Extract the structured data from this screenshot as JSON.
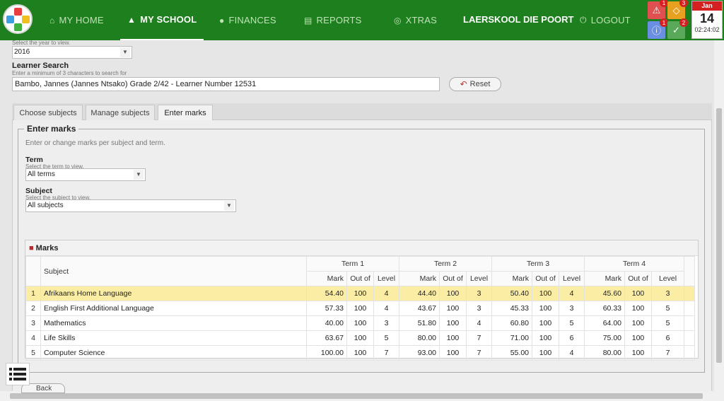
{
  "nav": {
    "items": [
      {
        "label": "MY HOME",
        "icon": "home-icon"
      },
      {
        "label": "MY SCHOOL",
        "icon": "school-icon"
      },
      {
        "label": "FINANCES",
        "icon": "money-bag-icon"
      },
      {
        "label": "REPORTS",
        "icon": "document-icon"
      },
      {
        "label": "XTRAS",
        "icon": "crosshair-icon"
      }
    ],
    "active": "MY SCHOOL",
    "school_name": "LAERSKOOL DIE POORT",
    "logout": "LOGOUT"
  },
  "notifications": [
    {
      "icon": "warning-triangle-icon",
      "count": "1",
      "color": "#e05050"
    },
    {
      "icon": "warning-diamond-icon",
      "count": "3",
      "color": "#e8a020"
    },
    {
      "icon": "info-icon",
      "count": "1",
      "color": "#6a8fe0"
    },
    {
      "icon": "check-icon",
      "count": "2",
      "color": "#5aa85a"
    }
  ],
  "date": {
    "month": "Jan",
    "day": "14",
    "time": "02:24:02"
  },
  "year": {
    "hint": "Select the year to view.",
    "value": "2016"
  },
  "learner_search": {
    "label": "Learner Search",
    "hint": "Enter a minimum of 3 characters to search for",
    "value": "Bambo, Jannes (Jannes Ntsako) Grade 2/42 - Learner Number 12531",
    "reset": "Reset"
  },
  "tabs": [
    "Choose subjects",
    "Manage subjects",
    "Enter marks"
  ],
  "active_tab": "Enter marks",
  "enter_marks": {
    "title": "Enter marks",
    "description": "Enter or change marks per subject and term.",
    "term": {
      "label": "Term",
      "hint": "Select the term to view.",
      "value": "All terms"
    },
    "subject": {
      "label": "Subject",
      "hint": "Select the subject to view.",
      "value": "All subjects"
    }
  },
  "marks": {
    "caption": "Marks",
    "subject_header": "Subject",
    "terms": [
      "Term 1",
      "Term 2",
      "Term 3",
      "Term 4"
    ],
    "subcols": [
      "Mark",
      "Out of",
      "Level"
    ],
    "rows": [
      {
        "n": "1",
        "subject": "Afrikaans Home Language",
        "t": [
          [
            "54.40",
            "100",
            "4"
          ],
          [
            "44.40",
            "100",
            "3"
          ],
          [
            "50.40",
            "100",
            "4"
          ],
          [
            "45.60",
            "100",
            "3"
          ]
        ]
      },
      {
        "n": "2",
        "subject": "English First Additional Language",
        "t": [
          [
            "57.33",
            "100",
            "4"
          ],
          [
            "43.67",
            "100",
            "3"
          ],
          [
            "45.33",
            "100",
            "3"
          ],
          [
            "60.33",
            "100",
            "5"
          ]
        ]
      },
      {
        "n": "3",
        "subject": "Mathematics",
        "t": [
          [
            "40.00",
            "100",
            "3"
          ],
          [
            "51.80",
            "100",
            "4"
          ],
          [
            "60.80",
            "100",
            "5"
          ],
          [
            "64.00",
            "100",
            "5"
          ]
        ]
      },
      {
        "n": "4",
        "subject": "Life Skills",
        "t": [
          [
            "63.67",
            "100",
            "5"
          ],
          [
            "80.00",
            "100",
            "7"
          ],
          [
            "71.00",
            "100",
            "6"
          ],
          [
            "75.00",
            "100",
            "6"
          ]
        ]
      },
      {
        "n": "5",
        "subject": "Computer Science",
        "t": [
          [
            "100.00",
            "100",
            "7"
          ],
          [
            "93.00",
            "100",
            "7"
          ],
          [
            "55.00",
            "100",
            "4"
          ],
          [
            "80.00",
            "100",
            "7"
          ]
        ]
      }
    ],
    "selected_row": 0
  },
  "back": "Back"
}
